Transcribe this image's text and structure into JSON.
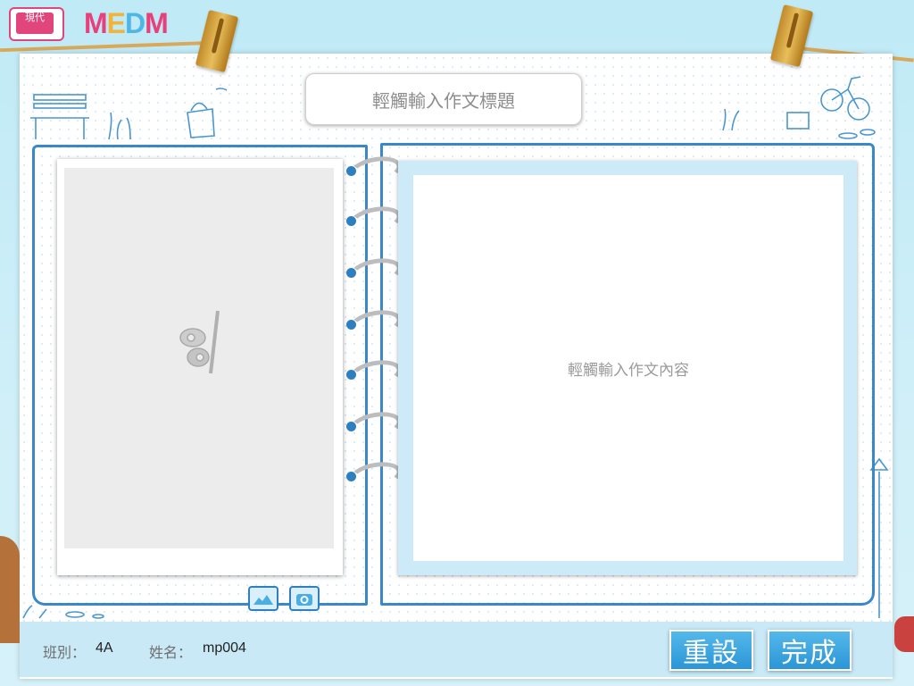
{
  "header": {
    "logo_modern_text": "現代",
    "logo_medm_letters": [
      {
        "ch": "M",
        "color": "#e8407c"
      },
      {
        "ch": "E",
        "color": "#f2b33a"
      },
      {
        "ch": "D",
        "color": "#4fb6e8"
      },
      {
        "ch": "M",
        "color": "#e8407c"
      }
    ]
  },
  "editor": {
    "title_placeholder": "輕觸輸入作文標題",
    "content_placeholder": "輕觸輸入作文內容"
  },
  "footer": {
    "class_label": "班別：",
    "class_value": "4A",
    "name_label": "姓名：",
    "name_value": "mp004",
    "reset_button": "重設",
    "done_button": "完成"
  },
  "icons": {
    "photo_placeholder": "pen-feather-icon",
    "gallery": "image-gallery-icon",
    "camera": "camera-icon"
  },
  "colors": {
    "accent": "#3b88c8",
    "button": "#2b95d6",
    "bar": "#c9e9f7"
  }
}
